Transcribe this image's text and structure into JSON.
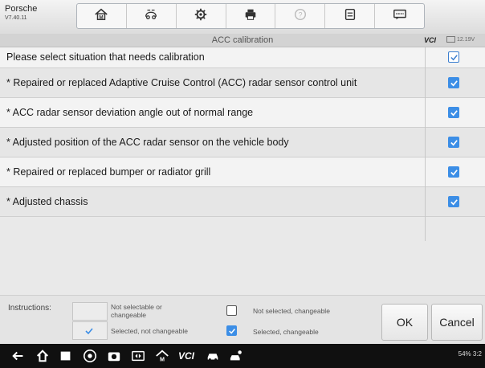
{
  "header": {
    "vehicle_name": "Porsche",
    "version": "V7.40.11",
    "toolbar_icons": [
      "home-icon",
      "vehicle-swap-icon",
      "settings-icon",
      "print-icon",
      "help-icon",
      "save-icon",
      "data-logging-icon"
    ]
  },
  "titlebar": {
    "title": "ACC calibration",
    "vci_label": "VCI",
    "voltage": "12.19V"
  },
  "list": {
    "header": {
      "label": "Please select situation that needs calibration",
      "checked": false
    },
    "rows": [
      {
        "label": "* Repaired or replaced Adaptive Cruise Control (ACC) radar sensor control unit",
        "checked": true
      },
      {
        "label": "* ACC radar sensor deviation angle out of normal range",
        "checked": true
      },
      {
        "label": "* Adjusted position of the ACC radar sensor on the vehicle body",
        "checked": true
      },
      {
        "label": "* Repaired or replaced bumper or radiator grill",
        "checked": true
      },
      {
        "label": "* Adjusted chassis",
        "checked": true
      }
    ]
  },
  "footer": {
    "instructions_label": "Instructions:",
    "legend": {
      "not_selectable": "Not selectable or changeable",
      "selected_not_changeable": "Selected, not changeable",
      "not_selected_changeable": "Not selected, changeable",
      "selected_changeable": "Selected, changeable"
    },
    "ok_label": "OK",
    "cancel_label": "Cancel"
  },
  "navbar": {
    "icons": [
      "back-icon",
      "home-icon",
      "recent-apps-icon",
      "browser-icon",
      "camera-icon",
      "screen-mirror-icon",
      "maxi-home-icon",
      "vci-icon",
      "car-icon",
      "car-person-icon"
    ],
    "vci_text": "VCI",
    "status": "54%",
    "time": "3:2"
  },
  "colors": {
    "accent": "#3c8ee6",
    "row_light": "#f3f3f3",
    "row_dark": "#e6e6e6",
    "navbar": "#101010"
  }
}
